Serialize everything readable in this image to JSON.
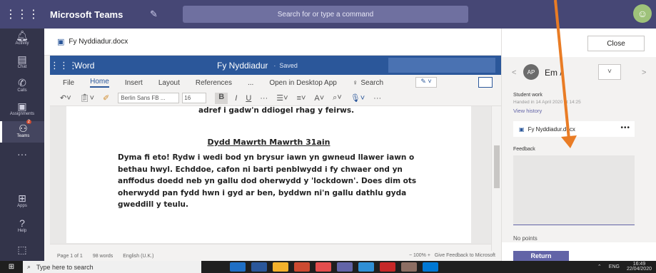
{
  "teams": {
    "app_title": "Microsoft Teams",
    "search_placeholder": "Search for or type a command",
    "rail": [
      {
        "label": "Activity",
        "icon": "bell-icon"
      },
      {
        "label": "Chat",
        "icon": "chat-icon"
      },
      {
        "label": "Calls",
        "icon": "phone-icon"
      },
      {
        "label": "Assignments",
        "icon": "assignments-icon"
      },
      {
        "label": "Teams",
        "icon": "teams-icon",
        "badge": "2"
      },
      {
        "label": "Apps",
        "icon": "apps-icon"
      },
      {
        "label": "Help",
        "icon": "help-icon"
      }
    ]
  },
  "file": {
    "title": "Fy Nyddiadur.docx"
  },
  "word": {
    "brand": "Word",
    "doc_name": "Fy Nyddiadur",
    "saved": "Saved",
    "tabs": [
      "File",
      "Home",
      "Insert",
      "Layout",
      "References",
      "...",
      "Open in Desktop App"
    ],
    "search_label": "Search",
    "font": "Berlin Sans FB ...",
    "font_size": "16",
    "bold": "B",
    "italic": "I",
    "underline": "U"
  },
  "document": {
    "cut_line": "adref i gadw'n ddiogel rhag y feirws.",
    "heading": "Dydd Mawrth Mawrth 31ain",
    "body": "Dyma fi eto!  Rydw i wedi bod yn brysur iawn yn gwneud llawer iawn o bethau hwyl.  Echddoe, cafon ni barti penblwydd i fy chwaer ond yn anffodus doedd neb yn gallu dod oherwydd y 'lockdown'.  Does dim ots oherwydd pan fydd hwn i gyd ar ben, byddwn ni'n gallu dathlu gyda gweddill y teulu."
  },
  "status": {
    "page": "Page 1 of 1",
    "words": "98 words",
    "language": "English (U.K.)",
    "zoom": "100%",
    "feedback": "Give Feedback to Microsoft"
  },
  "panel": {
    "close": "Close",
    "avatar": "AP",
    "student_name": "Em /",
    "student_work_label": "Student work",
    "handed_in": "Handed in 14 April 2020 at 14:25",
    "view_history": "View history",
    "file_name": "Fy Nyddiadur.docx",
    "feedback_label": "Feedback",
    "points": "No points",
    "return": "Return"
  },
  "taskbar": {
    "search_placeholder": "Type here to search",
    "lang": "ENG",
    "time": "16:49",
    "date": "22/04/2020",
    "app_colors": [
      "#1f6fc5",
      "#2b579a",
      "#f3b12b",
      "#cc4a31",
      "#e34d4d",
      "#6264a7",
      "#2f8fd5",
      "#c62828",
      "#8d6e63",
      "#0078d4"
    ]
  }
}
